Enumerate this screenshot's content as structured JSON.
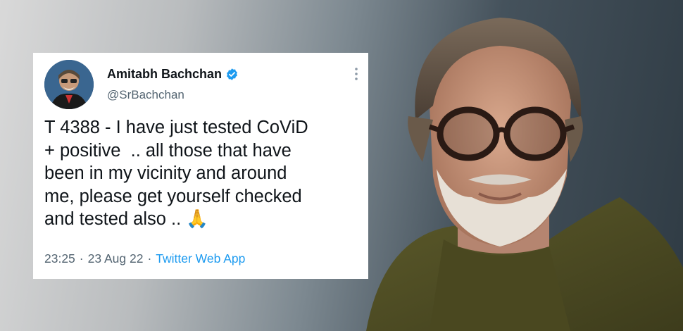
{
  "tweet": {
    "display_name": "Amitabh Bachchan",
    "handle": "@SrBachchan",
    "text": "T 4388 - I have just tested CoViD\n+ positive  .. all those that have\nbeen in my vicinity and around\nme, please get yourself checked\nand tested also .. 🙏",
    "time": "23:25",
    "separator": "·",
    "date": "23 Aug 22",
    "source_app": "Twitter Web App",
    "verified": true
  },
  "icons": {
    "verified": "verified-badge-icon",
    "more": "more-vertical-icon"
  },
  "colors": {
    "accent": "#1d9bf0",
    "muted_text": "#536471",
    "main_text": "#0f1419"
  }
}
